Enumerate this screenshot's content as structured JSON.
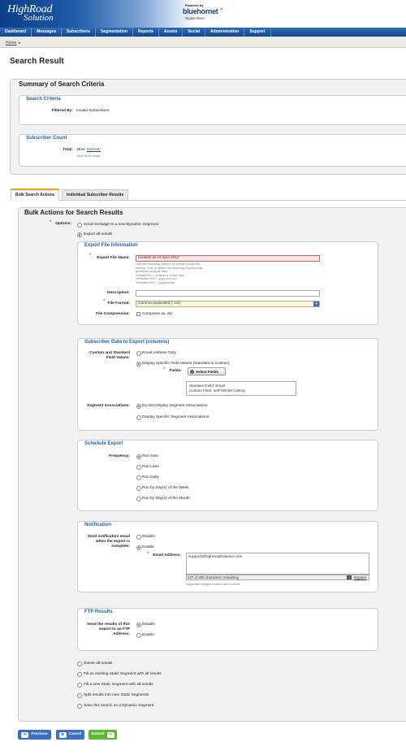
{
  "header": {
    "logo_top": "HighRoad",
    "logo_bottom": "Solution",
    "powered_by": "Powered by",
    "partner": "bluehornet",
    "partner_star": "★",
    "parent": "Digital River"
  },
  "nav": [
    "Dashboard",
    "Messages",
    "Subscribers",
    "Segmentation",
    "Reports",
    "Assets",
    "Social",
    "Administration",
    "Support"
  ],
  "breadcrumb": {
    "home": "Home",
    "arrow": "▸"
  },
  "page_title": "Search Result",
  "summary": {
    "title": "Summary of Search Criteria",
    "criteria_title": "Search Criteria",
    "filtered_by_label": "Filtered By:",
    "filtered_by_value": "Invalid Subscribers",
    "count_title": "Subscriber Count",
    "total_label": "Total:",
    "total_value": "4534",
    "refresh": "Refresh",
    "total_note": "Total as of today."
  },
  "tabs": [
    "Bulk Search Actions",
    "Individual Subscriber Results"
  ],
  "bulk": {
    "title": "Bulk Actions for Search Results",
    "options_label": "Options:",
    "opt_dynamic": "Send message to a new Dynamic Segment",
    "opt_export": "Export all results",
    "export_info": {
      "title": "Export File Information",
      "file_name_label": "Export File Name:",
      "file_name_value": "Invalids as of April 2012",
      "token_help": [
        "Use the following tokens to create unique file",
        "names. This is useful for recurring exports that",
        "generate multiple files",
        "%%dst%% = unique id of the task",
        "%%date1%% = yyyy-mm-dd",
        "%%date2%% = yyyymmdd"
      ],
      "description_label": "Description:",
      "file_format_label": "File Format:",
      "file_format_value": "Comma separated (.csv)",
      "compression_label": "File Compression:",
      "compression_option": "Compress as .zip"
    },
    "subscriber_data": {
      "title": "Subscriber Data to Export (columns)",
      "custom_label_1": "Custom and Standard",
      "custom_label_2": "Field Values:",
      "opt_email_only": "Email Address Only",
      "opt_display_specific": "Display Specific Field Values (Standard & Custom)",
      "fields_label": "Fields:",
      "select_fields": "Select Fields",
      "field_list": [
        "Standard Field: Email",
        "Custom Field: netFORUM CstKey"
      ],
      "segment_label": "Segment Associations:",
      "opt_no_segment": "Do Not Display Segment Associations",
      "opt_specific_segment": "Display Specific Segment Associations"
    },
    "schedule": {
      "title": "Schedule Export",
      "frequency_label": "Frequency:",
      "options": [
        "Run Now",
        "Run Later",
        "Run Daily",
        "Run by Day(s) of the Week",
        "Run by Day(s) of the Month"
      ]
    },
    "notification": {
      "title": "Notification",
      "label_1": "Send notification email",
      "label_2": "when the export is",
      "label_3": "complete:",
      "opt_disable": "Disable",
      "opt_enable": "Enable",
      "email_label": "Email Address:",
      "email_value": "support@highroadsolution.com",
      "remaining": "227 of 255 characters remaining",
      "expand": "Expand",
      "help": "Separate multiple entries with a return"
    },
    "ftp": {
      "title": "FTP Results",
      "label_1": "Send the results of this",
      "label_2": "export to an FTP",
      "label_3": "Address:",
      "opt_disable": "Disable",
      "opt_enable": "Enable"
    },
    "other_options": [
      "Delete all results",
      "Fill an existing Static Segment with all results",
      "Fill a new Static Segment with all results",
      "Split results into new Static Segments",
      "Save this search as a Dynamic Segment"
    ]
  },
  "buttons": {
    "previous": "Previous",
    "cancel": "Cancel",
    "submit": "Submit"
  },
  "colors": {
    "nav": "#1d56a3",
    "heading_blue": "#1e64ac",
    "required": "#e36c0a",
    "submit_green": "#5cb82f",
    "button_blue": "#3b6fc4"
  }
}
